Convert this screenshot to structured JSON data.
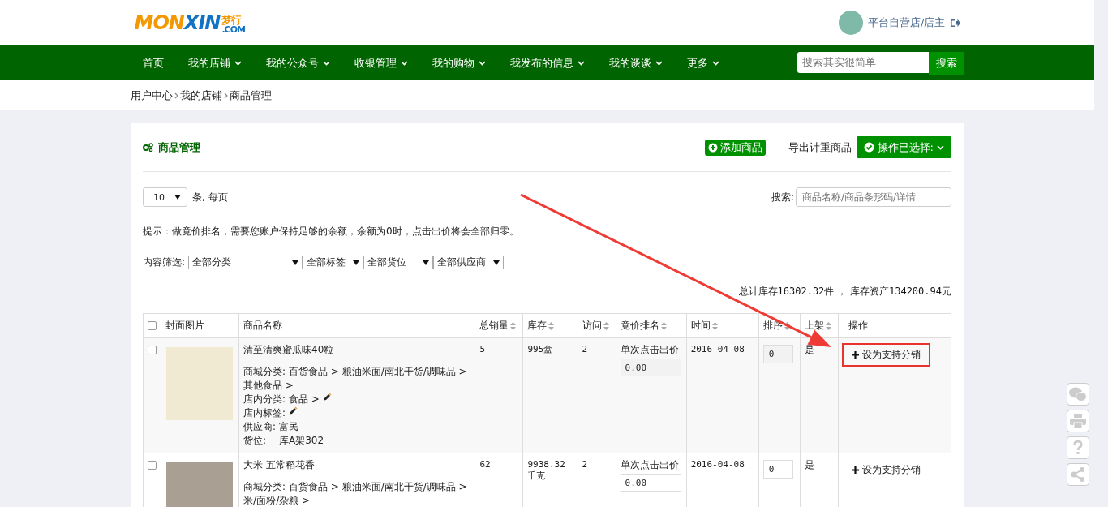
{
  "header": {
    "logo": {
      "parts": [
        {
          "text": "MON",
          "color": "#f39800"
        },
        {
          "text": "XIN",
          "color": "#1272c4"
        }
      ],
      "cn": "梦行",
      "domain": ".COM"
    },
    "user": "平台自营店/店主"
  },
  "nav": {
    "items": [
      {
        "label": "首页",
        "dropdown": false
      },
      {
        "label": "我的店铺",
        "dropdown": true
      },
      {
        "label": "我的公众号",
        "dropdown": true
      },
      {
        "label": "收银管理",
        "dropdown": true
      },
      {
        "label": "我的购物",
        "dropdown": true
      },
      {
        "label": "我发布的信息",
        "dropdown": true
      },
      {
        "label": "我的谈谈",
        "dropdown": true
      },
      {
        "label": "更多",
        "dropdown": true
      }
    ],
    "search": {
      "placeholder": "搜索其实很简单",
      "button": "搜索"
    }
  },
  "breadcrumb": [
    "用户中心",
    "我的店铺",
    "商品管理"
  ],
  "panel": {
    "title": "商品管理",
    "add_button": "添加商品",
    "export_link": "导出计重商品",
    "action_button": "操作已选择:",
    "page_size": "10",
    "page_size_label": "条, 每页",
    "search_label": "搜索:",
    "search_placeholder": "商品名称/商品条形码/详情",
    "tip": "提示：做竟价排名，需要您账户保持足够的余额，余额为0时，点击出价将会全部归零。",
    "filter_label": "内容筛选:",
    "filters": [
      "全部分类",
      "全部标签",
      "全部货位",
      "全部供应商"
    ],
    "totals": "总计库存**16302.32**件 ， 库存资产**134200.94**元",
    "table": {
      "all_checked": false,
      "columns": [
        {
          "label": "封面图片",
          "sortable": false
        },
        {
          "label": "商品名称",
          "sortable": false
        },
        {
          "label": "总销量",
          "sortable": true
        },
        {
          "label": "库存",
          "sortable": true
        },
        {
          "label": "访问",
          "sortable": true
        },
        {
          "label": "竟价排名",
          "sortable": true
        },
        {
          "label": "时间",
          "sortable": true
        },
        {
          "label": "排序",
          "sortable": true
        },
        {
          "label": "上架",
          "sortable": true
        },
        {
          "label": "操作",
          "sortable": false
        }
      ],
      "rows": [
        {
          "checked": false,
          "highlighted": true,
          "callout": true,
          "name": "清至清爽蜜瓜味40粒",
          "details": [
            {
              "kind": "text",
              "text": "商城分类: 百货食品 > 粮油米面/南北干货/调味品 > 其他食品 >"
            },
            {
              "kind": "editable",
              "text": "店内分类: 食品 >"
            },
            {
              "kind": "editable",
              "text": "店内标签:"
            },
            {
              "kind": "text",
              "text": "供应商: 富民"
            },
            {
              "kind": "text",
              "text": "货位: 一库A架302"
            }
          ],
          "sales": "5",
          "stock": "995盒",
          "visits": "2",
          "bid_label": "单次点击出价",
          "bid": "0.00",
          "time": "2016-04-08",
          "sort": "0",
          "on_shelf": "是",
          "action": "设为支持分销"
        },
        {
          "checked": false,
          "highlighted": false,
          "callout": false,
          "name": "大米 五常稻花香",
          "details": [
            {
              "kind": "text",
              "text": "商城分类: 百货食品 > 粮油米面/南北干货/调味品 > 米/面粉/杂粮 >"
            }
          ],
          "sales": "62",
          "stock": "9938.32千克",
          "visits": "2",
          "bid_label": "单次点击出价",
          "bid": "0.00",
          "time": "2016-04-08",
          "sort": "0",
          "on_shelf": "是",
          "action": "设为支持分销"
        }
      ]
    }
  }
}
